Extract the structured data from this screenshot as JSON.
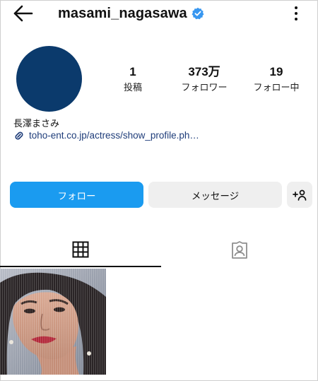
{
  "header": {
    "username": "masami_nagasawa",
    "back_icon": "arrow-left-icon",
    "verified_icon": "verified-badge-icon",
    "more_icon": "more-vertical-icon"
  },
  "profile": {
    "display_name": "長澤まさみ",
    "link_text": "toho-ent.co.jp/actress/show_profile.ph…",
    "link_icon": "link-icon",
    "avatar_color": "#0b3a6c",
    "stats": {
      "posts": {
        "value": "1",
        "label": "投稿"
      },
      "followers": {
        "value": "373万",
        "label": "フォロワー"
      },
      "following": {
        "value": "19",
        "label": "フォロー中"
      }
    }
  },
  "actions": {
    "follow_label": "フォロー",
    "message_label": "メッセージ",
    "suggest_icon": "add-person-icon",
    "follow_color": "#1a9bf0"
  },
  "tabs": [
    {
      "icon": "grid-icon",
      "active": true
    },
    {
      "icon": "tagged-person-icon",
      "active": false
    }
  ],
  "posts": [
    {
      "thumbnail": "portrait-photo"
    }
  ]
}
